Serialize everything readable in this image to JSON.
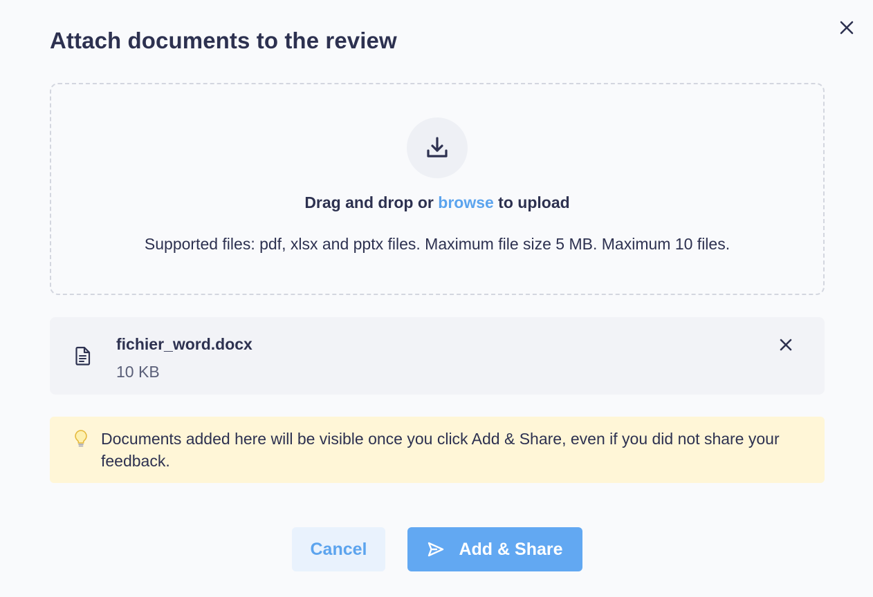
{
  "modal": {
    "title": "Attach documents to the review",
    "close_icon": "close-icon"
  },
  "dropzone": {
    "upload_icon": "download-tray-icon",
    "text_before": "Drag and drop or ",
    "browse_label": "browse",
    "text_after": " to upload",
    "supported_text": "Supported files: pdf, xlsx and pptx files. Maximum file size 5 MB. Maximum 10 files."
  },
  "files": [
    {
      "icon": "document-icon",
      "name": "fichier_word.docx",
      "size": "10 KB",
      "remove_icon": "close-icon"
    }
  ],
  "notice": {
    "icon": "lightbulb-icon",
    "text": "Documents added here will be visible once you click Add & Share, even if you did not share your feedback."
  },
  "footer": {
    "cancel_label": "Cancel",
    "share_label": "Add & Share",
    "share_icon": "send-icon"
  },
  "colors": {
    "text_primary": "#2d3150",
    "accent": "#5ca4ee",
    "primary_button": "#62a8f2",
    "secondary_button_bg": "#e9f2fd",
    "notice_bg": "#fff6d7",
    "file_card_bg": "#f2f3f7"
  }
}
